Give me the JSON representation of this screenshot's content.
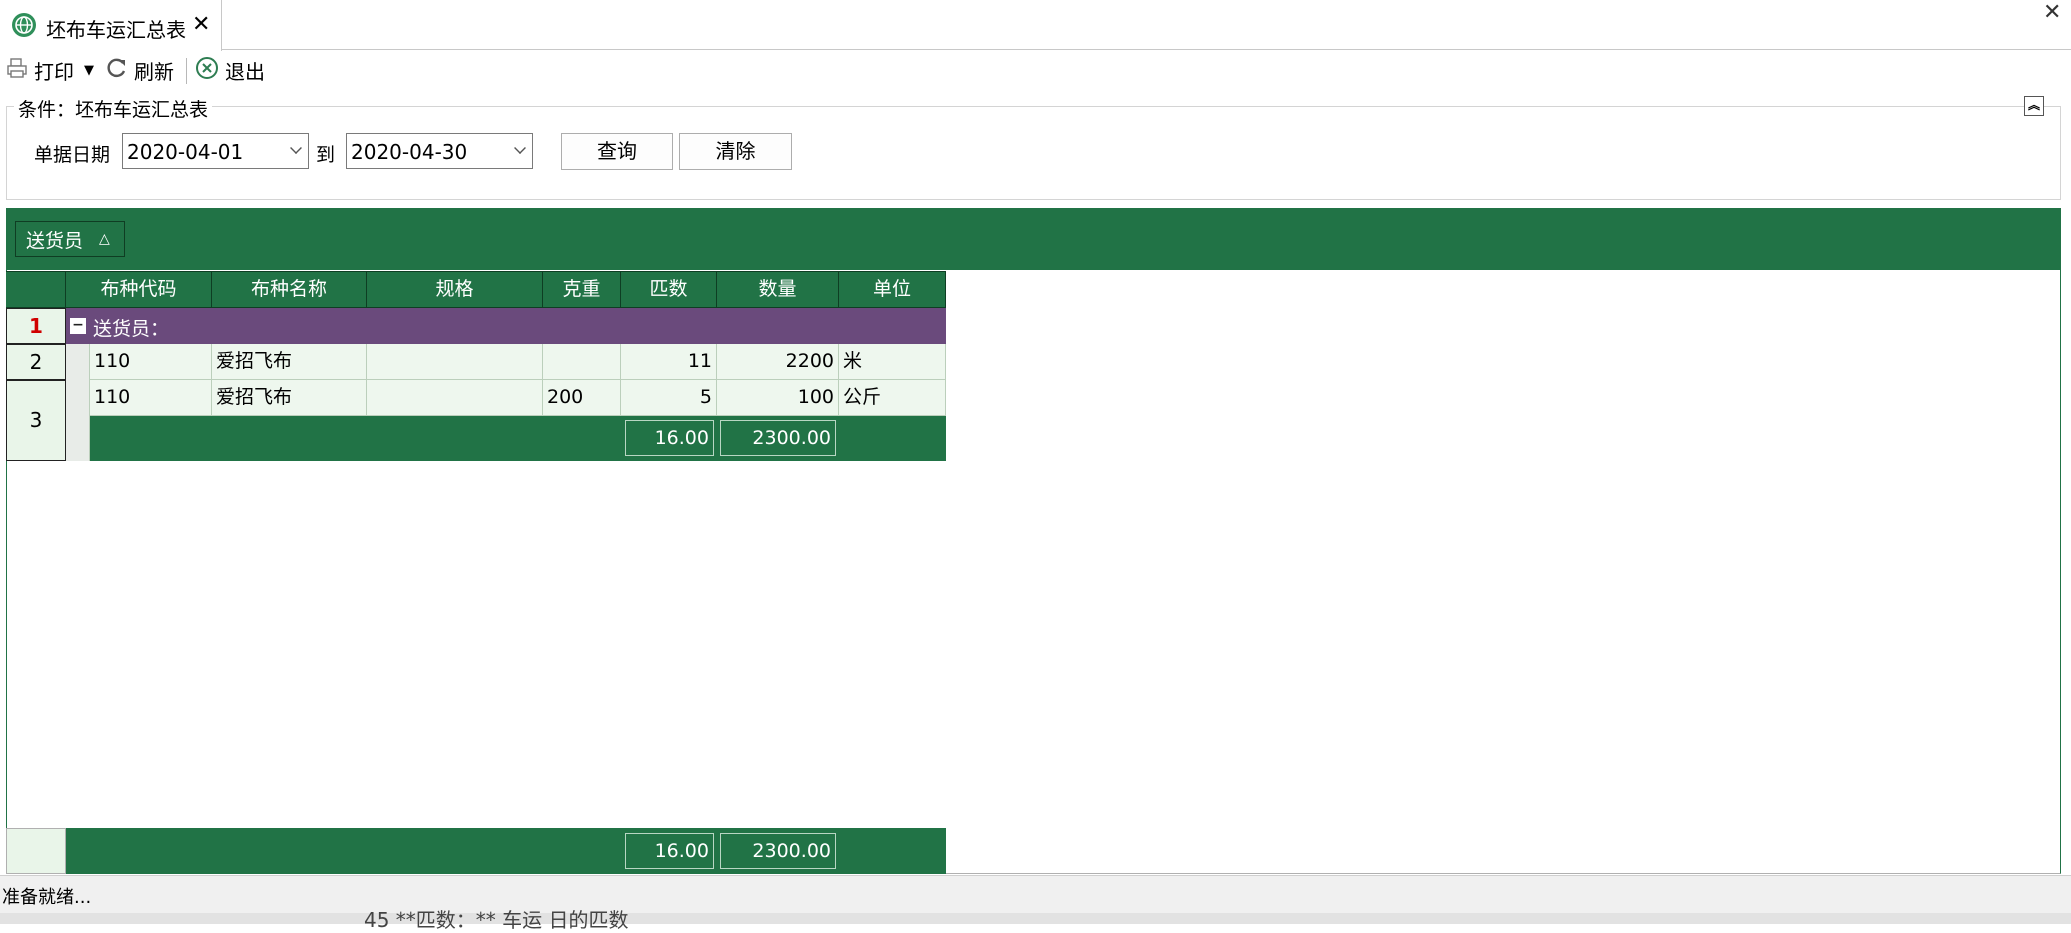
{
  "window": {
    "tab_title": "坯布车运汇总表",
    "tab_close": "✕",
    "window_close": "✕",
    "tab_icon": "globe-icon"
  },
  "toolbar": {
    "print_label": "打印",
    "refresh_label": "刷新",
    "exit_label": "退出"
  },
  "conditions": {
    "title": "条件：坯布车运汇总表",
    "date_label": "单据日期",
    "date_from": "2020-04-01",
    "to_label": "到",
    "date_to": "2020-04-30",
    "query_label": "查询",
    "clear_label": "清除"
  },
  "group_panel": {
    "chip_label": "送货员",
    "sort_glyph": "△"
  },
  "grid": {
    "columns": [
      "布种代码",
      "布种名称",
      "规格",
      "克重",
      "匹数",
      "数量",
      "单位"
    ],
    "row_numbers": [
      "1",
      "2",
      "3"
    ],
    "group_row": {
      "toggle": "−",
      "label": "送货员："
    },
    "rows": [
      {
        "code": "110",
        "name": "爱招飞布",
        "spec": "",
        "weight": "",
        "pieces": "11",
        "qty": "2200",
        "unit": "米"
      },
      {
        "code": "110",
        "name": "爱招飞布",
        "spec": "",
        "weight": "200",
        "pieces": "5",
        "qty": "100",
        "unit": "公斤"
      }
    ],
    "group_footer": {
      "pieces": "16.00",
      "qty": "2300.00"
    },
    "grand_footer": {
      "pieces": "16.00",
      "qty": "2300.00"
    }
  },
  "status": {
    "text": "准备就绪...",
    "behind_text": "45 **匹数：** 车运 日的匹数"
  },
  "colors": {
    "accent_green": "#217346",
    "group_purple": "#6a4a7c",
    "row_bg": "#eef7ee"
  }
}
